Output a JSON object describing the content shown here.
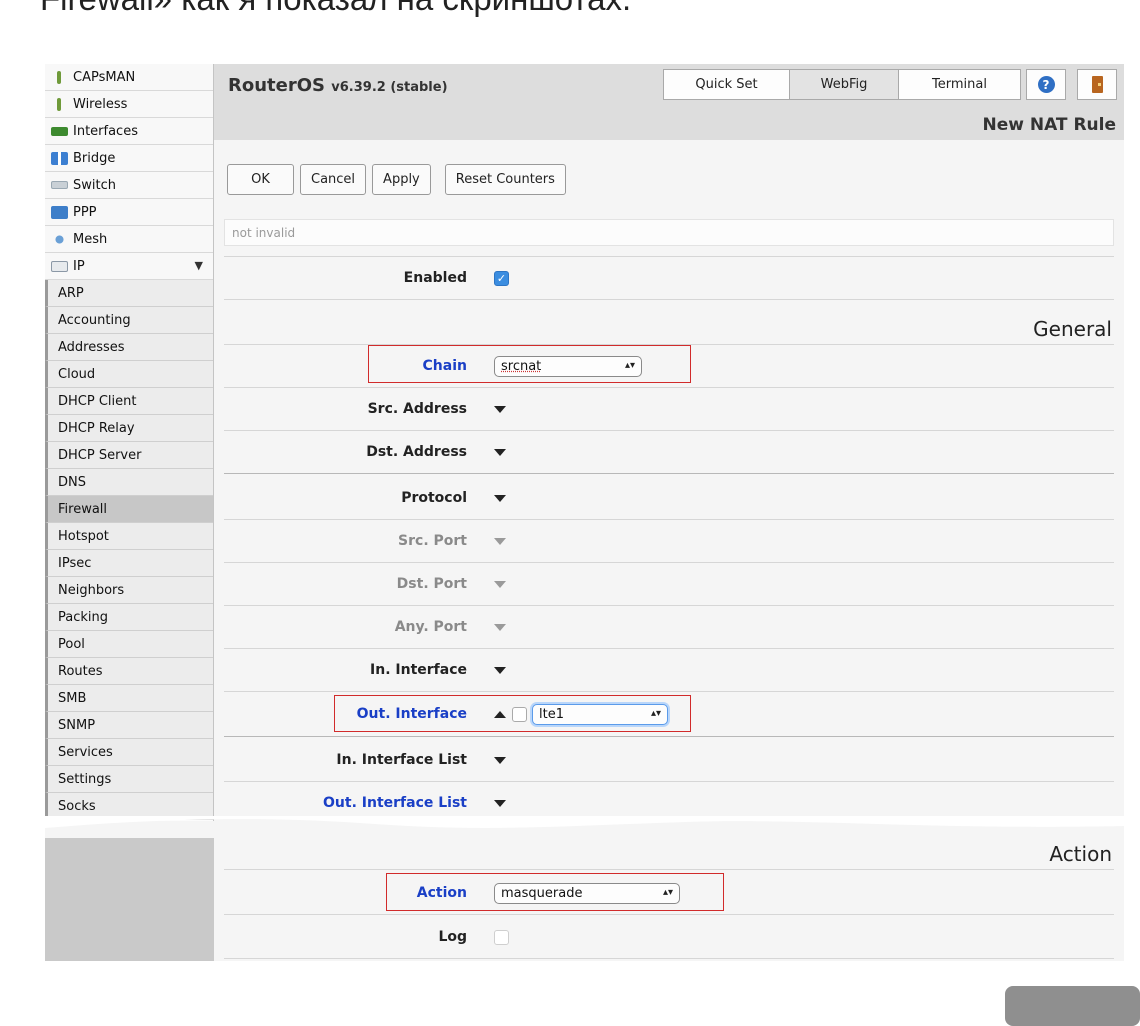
{
  "article": {
    "fragment": "Firewall» как я показал на скриншотах."
  },
  "sidebar": {
    "items": [
      {
        "label": "CAPsMAN",
        "icon": "antenna-icon",
        "color": "#6f9a3a"
      },
      {
        "label": "Wireless",
        "icon": "antenna-icon",
        "color": "#6f9a3a"
      },
      {
        "label": "Interfaces",
        "icon": "interfaces-icon",
        "color": "#3d8a2f"
      },
      {
        "label": "Bridge",
        "icon": "bridge-icon",
        "color": "#3c7fd1"
      },
      {
        "label": "Switch",
        "icon": "switch-icon",
        "color": "#9aa8b3"
      },
      {
        "label": "PPP",
        "icon": "ppp-icon",
        "color": "#3d7ec9"
      },
      {
        "label": "Mesh",
        "icon": "mesh-icon",
        "color": "#6aa0d6"
      },
      {
        "label": "IP",
        "icon": "ip-icon",
        "color": "#8b98a6",
        "expand": "▼"
      }
    ],
    "sub_items": [
      "ARP",
      "Accounting",
      "Addresses",
      "Cloud",
      "DHCP Client",
      "DHCP Relay",
      "DHCP Server",
      "DNS",
      "Firewall",
      "Hotspot",
      "IPsec",
      "Neighbors",
      "Packing",
      "Pool",
      "Routes",
      "SMB",
      "SNMP",
      "Services",
      "Settings",
      "Socks"
    ],
    "active_sub": "Firewall"
  },
  "header": {
    "brand": "RouterOS",
    "version": "v6.39.2 (stable)",
    "tabs": {
      "quick": "Quick Set",
      "webfig": "WebFig",
      "terminal": "Terminal"
    },
    "help_glyph": "?",
    "page_title": "New NAT Rule"
  },
  "buttons": {
    "ok": "OK",
    "cancel": "Cancel",
    "apply": "Apply",
    "reset": "Reset Counters"
  },
  "status": "not invalid",
  "form": {
    "enabled_label": "Enabled",
    "general_heading": "General",
    "chain_label": "Chain",
    "chain_value": "srcnat",
    "src_address_label": "Src. Address",
    "dst_address_label": "Dst. Address",
    "protocol_label": "Protocol",
    "src_port_label": "Src. Port",
    "dst_port_label": "Dst. Port",
    "any_port_label": "Any. Port",
    "in_interface_label": "In. Interface",
    "out_interface_label": "Out. Interface",
    "out_interface_value": "lte1",
    "in_interface_list_label": "In. Interface List",
    "out_interface_list_label": "Out. Interface List",
    "action_heading": "Action",
    "action_label": "Action",
    "action_value": "masquerade",
    "log_label": "Log"
  },
  "glyphs": {
    "check": "✓",
    "select_arrows": "▴▾"
  },
  "colors": {
    "link_blue": "#1a3fc6",
    "highlight_red": "#d12b2b",
    "checkbox_blue": "#3b8de0"
  }
}
